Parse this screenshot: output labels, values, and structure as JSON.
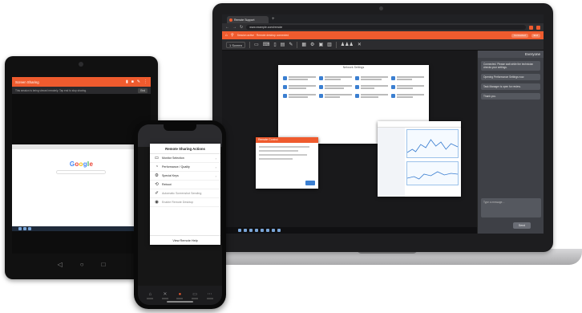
{
  "colors": {
    "accent": "#ef5b2e",
    "panel": "#3e4046",
    "link": "#3b7fd1"
  },
  "laptop": {
    "browser": {
      "tab_title": "Remote Support",
      "address": "www.example.com/remote",
      "nav_icons": [
        "back-icon",
        "forward-icon",
        "reload-icon"
      ]
    },
    "app_bar": {
      "status_text": "Session active · Remote desktop connected",
      "right_pill_1": "Connected",
      "right_pill_2": "End"
    },
    "toolbar": {
      "session_select": "1 Screen",
      "tool_icons": [
        "monitor-icon",
        "keyboard-icon",
        "mouse-icon",
        "clipboard-icon",
        "pen-icon",
        "file-icon",
        "gear-icon",
        "chat-icon",
        "users-icon",
        "close-icon"
      ]
    },
    "chat": {
      "title": "Everyone",
      "messages": [
        "Connected. Please wait while the technician checks your settings.",
        "Opening Performance Settings now.",
        "Task Manager is open for review.",
        "Thank you."
      ],
      "input_placeholder": "Type a message…",
      "send_label": "Send"
    },
    "remote_desktop": {
      "settings_title": "Network Settings",
      "dialog_title": "Remote Control"
    }
  },
  "tablet": {
    "bar_title": "Screen Sharing",
    "subbar_text": "This session is being viewed remotely. Tap end to stop sharing.",
    "subbar_button": "End",
    "browser_logo": "Google",
    "nav_icons": [
      "back-icon",
      "home-icon",
      "recents-icon"
    ]
  },
  "phone": {
    "menu_title": "Remote Sharing Actions",
    "menu_items": [
      {
        "icon": "monitor-icon",
        "label": "Monitor Selection"
      },
      {
        "icon": "gauge-icon",
        "label": "Performance / Quality"
      },
      {
        "icon": "gear-icon",
        "label": "Special Keys"
      },
      {
        "icon": "pin-icon",
        "label": "Reboot"
      },
      {
        "icon": "wrench-icon",
        "label": "Automatic Screenshot Sending"
      },
      {
        "icon": "eye-icon",
        "label": "Enable Remote Desktop"
      }
    ],
    "footer_label": "View Remote Help"
  }
}
